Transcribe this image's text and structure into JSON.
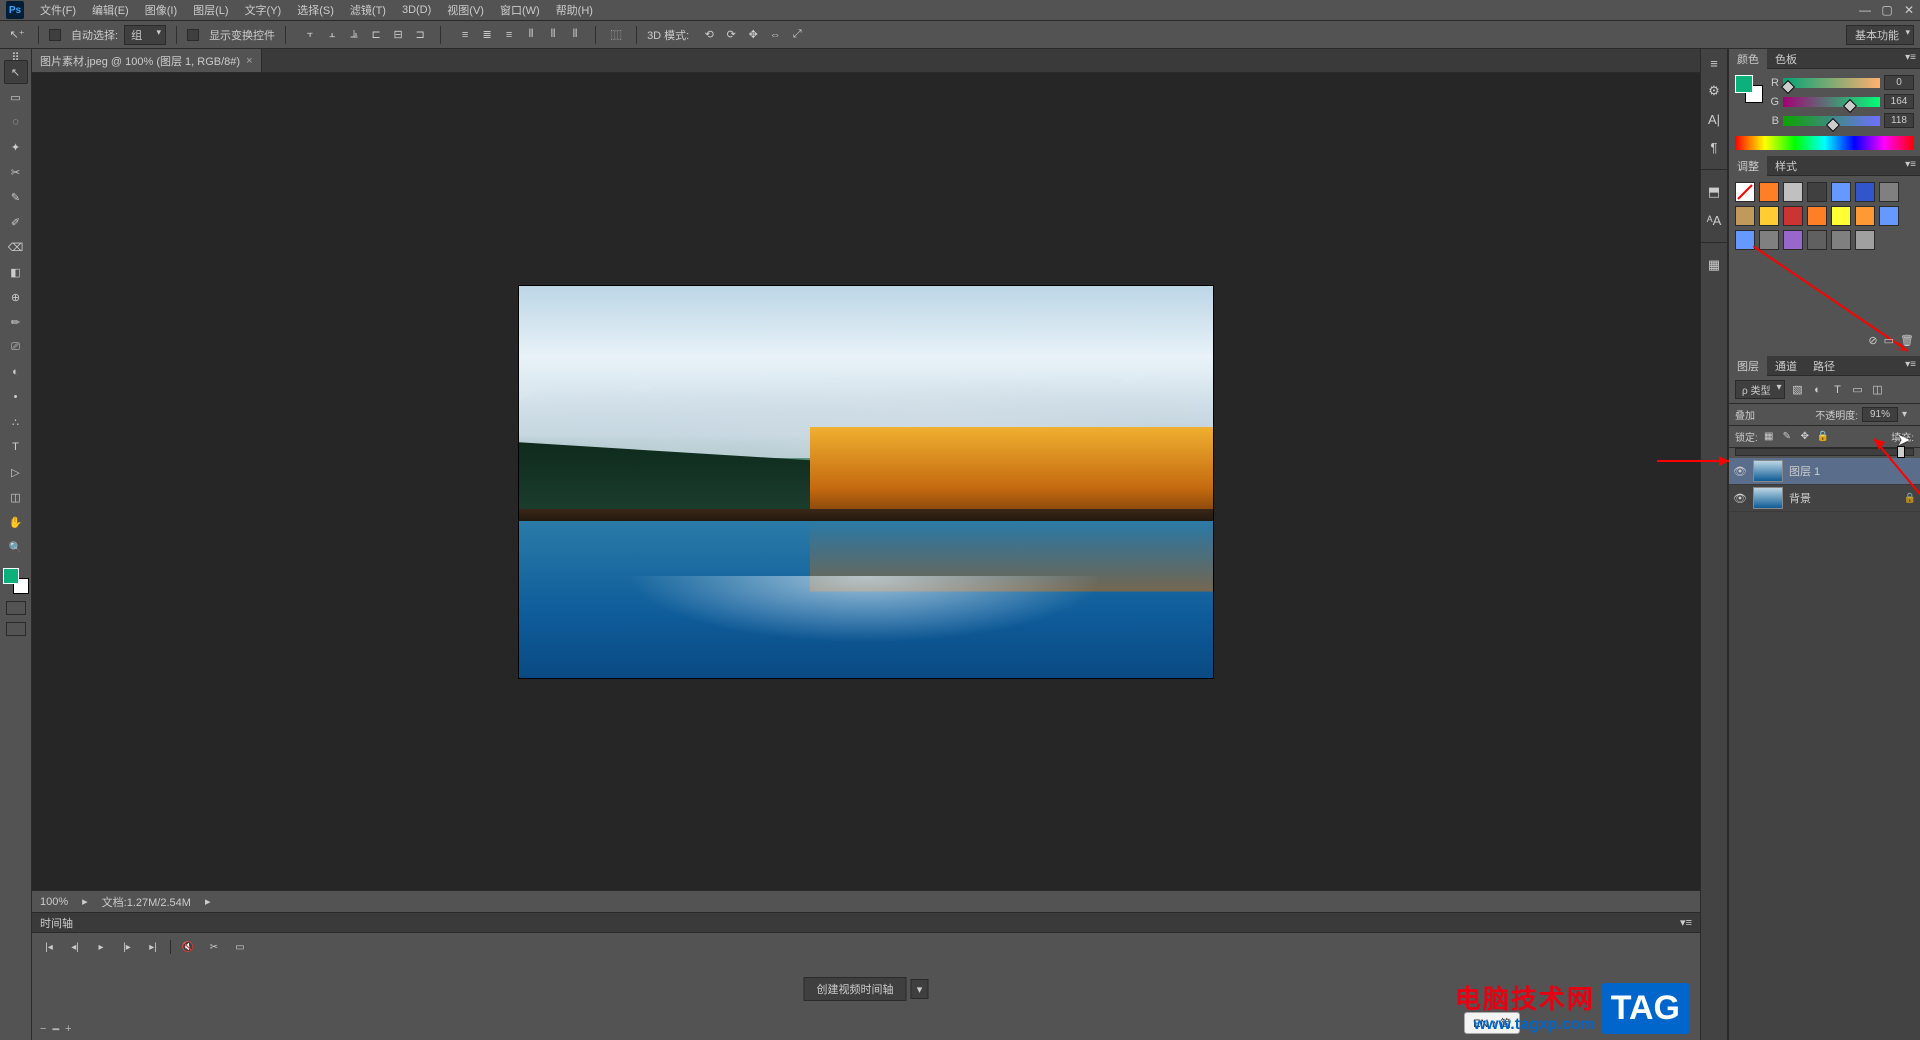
{
  "menubar": {
    "items": [
      "文件(F)",
      "编辑(E)",
      "图像(I)",
      "图层(L)",
      "文字(Y)",
      "选择(S)",
      "滤镜(T)",
      "3D(D)",
      "视图(V)",
      "窗口(W)",
      "帮助(H)"
    ]
  },
  "window_controls": {
    "min": "—",
    "max": "▢",
    "close": "✕"
  },
  "options_bar": {
    "auto_select_label": "自动选择:",
    "auto_select_value": "组",
    "show_transform_label": "显示变换控件",
    "mode_3d_label": "3D 模式:",
    "workspace": "基本功能"
  },
  "document_tab": {
    "title": "图片素材.jpeg @ 100% (图层 1, RGB/8#)",
    "close": "×"
  },
  "status": {
    "zoom": "100%",
    "docinfo": "文档:1.27M/2.54M"
  },
  "timeline": {
    "tab": "时间轴",
    "create_btn": "创建视频时间轴"
  },
  "ime": {
    "label": "EN ♪ 简"
  },
  "watermark": {
    "line1": "电脑技术网",
    "line2": "www.tagxp.com",
    "tag": "TAG"
  },
  "color_panel": {
    "tabs": [
      "颜色",
      "色板"
    ],
    "r": {
      "label": "R",
      "value": "0"
    },
    "g": {
      "label": "G",
      "value": "164"
    },
    "b": {
      "label": "B",
      "value": "118"
    }
  },
  "adjust_panel": {
    "tabs": [
      "调整",
      "样式"
    ],
    "swatches": [
      "#ffffff",
      "#ff7f27",
      "#c0c0c0",
      "#404040",
      "#6699ff",
      "#3355cc",
      "#808080",
      "#c09a5a",
      "#ffcc33",
      "#cc3333",
      "#ff7f27",
      "#ffff33",
      "#ff9933",
      "#6699ff",
      "#6699ff",
      "#808080",
      "#9966cc",
      "#606060",
      "#808080",
      "#a0a0a0"
    ]
  },
  "layers_panel": {
    "tabs": [
      "图层",
      "通道",
      "路径"
    ],
    "filter_label": "ρ 类型",
    "blend_mode": "叠加",
    "opacity_label": "不透明度:",
    "opacity_value": "91%",
    "lock_label": "锁定:",
    "fill_label": "填充:",
    "layers": [
      {
        "name": "图层 1",
        "selected": true,
        "locked": false
      },
      {
        "name": "背景",
        "selected": false,
        "locked": true
      }
    ]
  },
  "toolbox_icons": [
    "↖",
    "▭",
    "◌",
    "✦",
    "✂",
    "✎",
    "✐",
    "⌫",
    "◧",
    "⊕",
    "✏",
    "⎚",
    "◐",
    "•",
    "∴",
    "✎",
    "T",
    "▷",
    "◫",
    "✋",
    "🔍"
  ],
  "dock_icons_top": [
    "≡",
    "⚙",
    "A|",
    "¶"
  ],
  "dock_icons_mid": [
    "⬒",
    "ᴬA"
  ],
  "dock_icons_bot": [
    "▦"
  ]
}
